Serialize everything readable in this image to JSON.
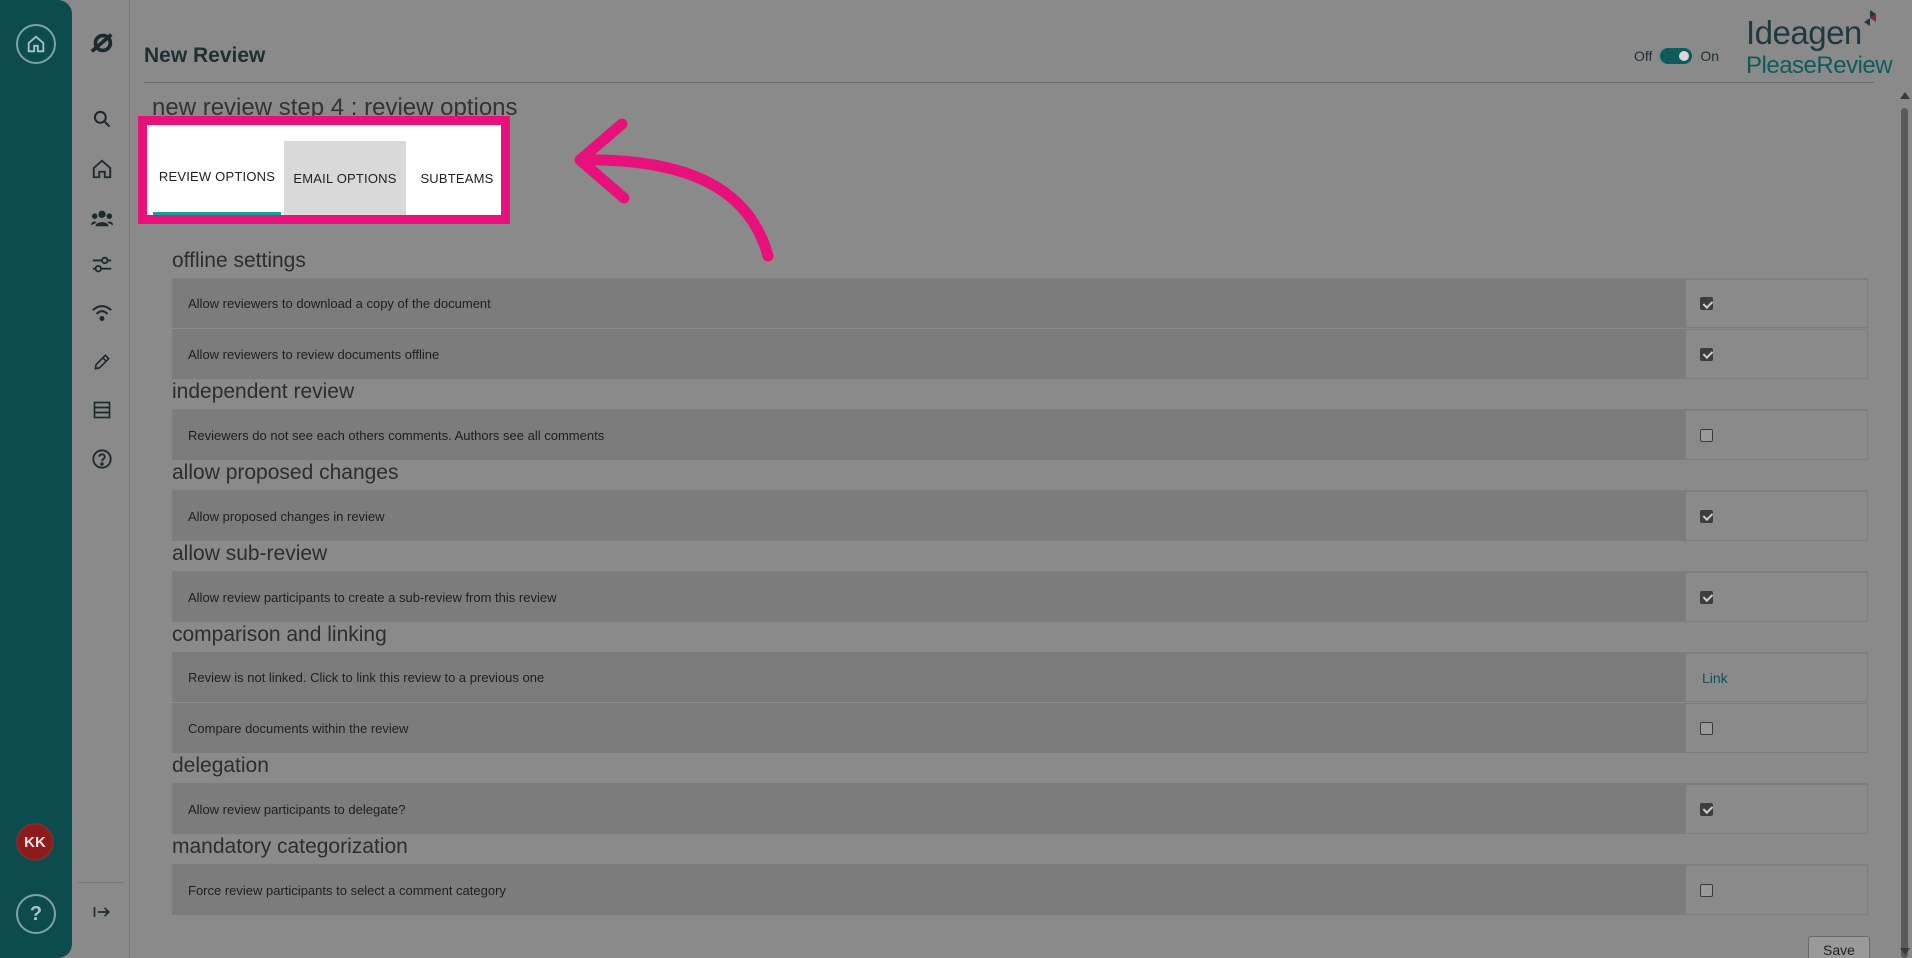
{
  "header": {
    "title": "New Review",
    "toggle_off": "Off",
    "toggle_on": "On"
  },
  "logo": {
    "line1": "Ideagen",
    "line2": "PleaseReview"
  },
  "page_subtitle": "new review step 4 : review options",
  "tabs": [
    {
      "label": "REVIEW OPTIONS",
      "active": true
    },
    {
      "label": "EMAIL OPTIONS",
      "active": false
    },
    {
      "label": "SUBTEAMS",
      "active": false
    }
  ],
  "user": {
    "initials": "KK"
  },
  "help_label": "?",
  "sections": [
    {
      "title": "offline settings",
      "rows": [
        {
          "label": "Allow reviewers to download a copy of the document",
          "checked": true
        },
        {
          "label": "Allow reviewers to review documents offline",
          "checked": true
        }
      ]
    },
    {
      "title": "independent review",
      "rows": [
        {
          "label": "Reviewers do not see each others comments. Authors see all comments",
          "checked": false
        }
      ]
    },
    {
      "title": "allow proposed changes",
      "rows": [
        {
          "label": "Allow proposed changes in review",
          "checked": true
        }
      ]
    },
    {
      "title": "allow sub-review",
      "rows": [
        {
          "label": "Allow review participants to create a sub-review from this review",
          "checked": true
        }
      ]
    },
    {
      "title": "comparison and linking",
      "rows": [
        {
          "label": "Review is not linked. Click to link this review to a previous one",
          "link": "Link"
        },
        {
          "label": "Compare documents within the review",
          "checked": false
        }
      ]
    },
    {
      "title": "delegation",
      "rows": [
        {
          "label": "Allow review participants to delegate?",
          "checked": true
        }
      ]
    },
    {
      "title": "mandatory categorization",
      "rows": [
        {
          "label": "Force review participants to select a comment category",
          "checked": false
        }
      ]
    }
  ],
  "save_label": "Save",
  "colors": {
    "rail": "#0c4c4c",
    "highlight": "#e8107a",
    "tab_underline": "#11a396"
  }
}
